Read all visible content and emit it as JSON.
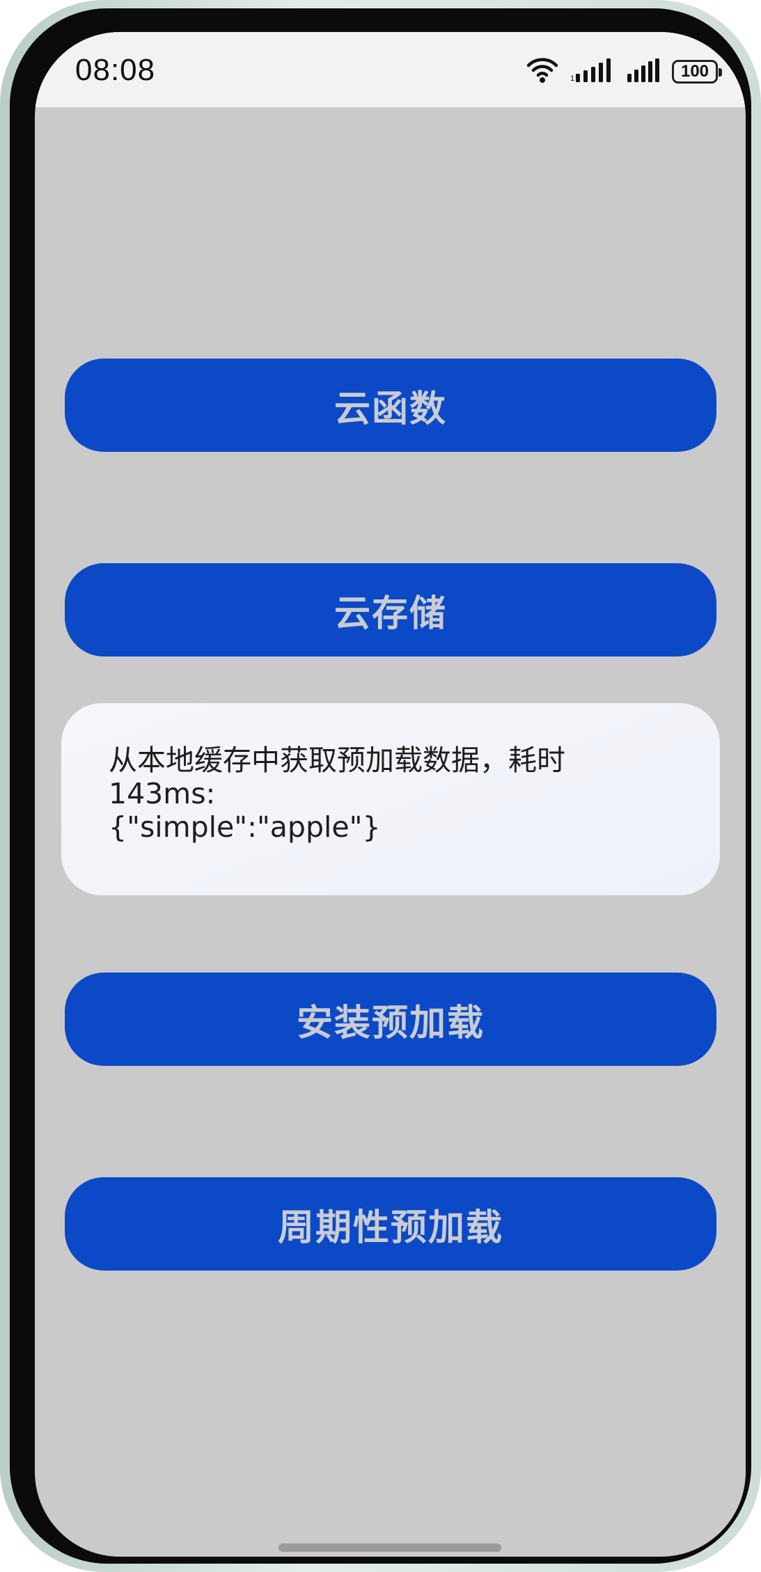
{
  "status_bar": {
    "time": "08:08",
    "battery": "100",
    "icons": [
      "wifi-icon",
      "signal-icon",
      "signal-icon",
      "battery-icon"
    ]
  },
  "buttons": {
    "cloud_function": "云函数",
    "cloud_storage": "云存储",
    "install_prefetch": "安装预加载",
    "periodic_prefetch": "周期性预加载"
  },
  "result": {
    "text": "从本地缓存中获取预加载数据，耗时\n143ms:\n{\"simple\":\"apple\"}"
  },
  "colors": {
    "button_bg": "#0b49c6",
    "button_text": "#c9ccd3",
    "screen_bg": "#cacaca",
    "card_bg": "#f3f5fa"
  }
}
